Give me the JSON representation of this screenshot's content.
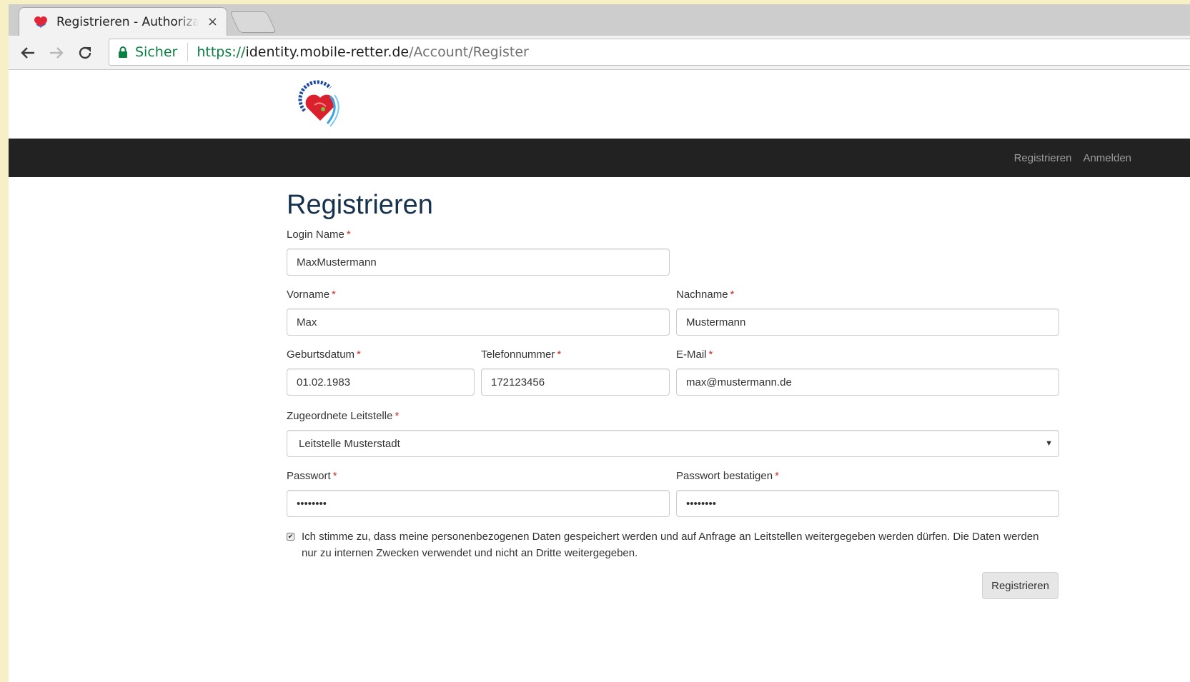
{
  "browser": {
    "tab_title": "Registrieren - Authorizati",
    "tab_close": "×",
    "secure_label": "Sicher",
    "url_scheme": "https://",
    "url_host": "identity.mobile-retter.de",
    "url_path": "/Account/Register"
  },
  "site": {
    "nav": {
      "register": "Registrieren",
      "login": "Anmelden"
    }
  },
  "form": {
    "heading": "Registrieren",
    "required_mark": "*",
    "login_name": {
      "label": "Login Name",
      "value": "MaxMustermann"
    },
    "first_name": {
      "label": "Vorname",
      "value": "Max"
    },
    "last_name": {
      "label": "Nachname",
      "value": "Mustermann"
    },
    "birthdate": {
      "label": "Geburtsdatum",
      "value": "01.02.1983"
    },
    "phone": {
      "label": "Telefonnummer",
      "value": "172123456"
    },
    "email": {
      "label": "E-Mail",
      "value": "max@mustermann.de"
    },
    "control_center": {
      "label": "Zugeordnete Leitstelle",
      "value": "Leitstelle Musterstadt"
    },
    "password": {
      "label": "Passwort",
      "value": "secret12"
    },
    "password_confirm": {
      "label": "Passwort bestatigen",
      "value": "secret12"
    },
    "consent": {
      "checked": true,
      "text": "Ich stimme zu, dass meine personenbezogenen Daten gespeichert werden und auf Anfrage an Leitstellen weitergegeben werden dürfen. Die Daten werden nur zu internen Zwecken verwendet und nicht an Dritte weitergegeben."
    },
    "submit_label": "Registrieren"
  },
  "colors": {
    "navbar": "#222222",
    "heading": "#16324f",
    "required": "#c9302c",
    "secure": "#0b8043"
  },
  "icons": [
    "heart-favicon-icon",
    "back-arrow-icon",
    "forward-arrow-icon",
    "reload-icon",
    "lock-icon",
    "mobile-retter-logo",
    "caret-down-icon",
    "checkbox-icon"
  ]
}
